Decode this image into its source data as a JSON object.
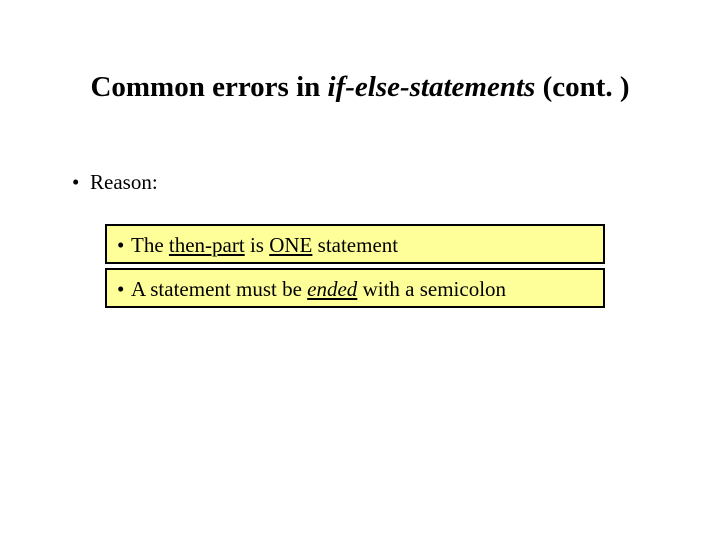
{
  "title": {
    "pre": "Common errors in ",
    "italic": "if-else-statements",
    "post": " (cont. )"
  },
  "reason": {
    "bullet": "•",
    "text": "Reason:"
  },
  "box1": {
    "bullet": "•",
    "t1": "The ",
    "then_part": "then-part",
    "t2": " is ",
    "one": "ONE",
    "t3": " statement"
  },
  "box2": {
    "bullet": "•",
    "t1": "A statement must be ",
    "ended": "ended",
    "t2": " with a semicolon"
  }
}
